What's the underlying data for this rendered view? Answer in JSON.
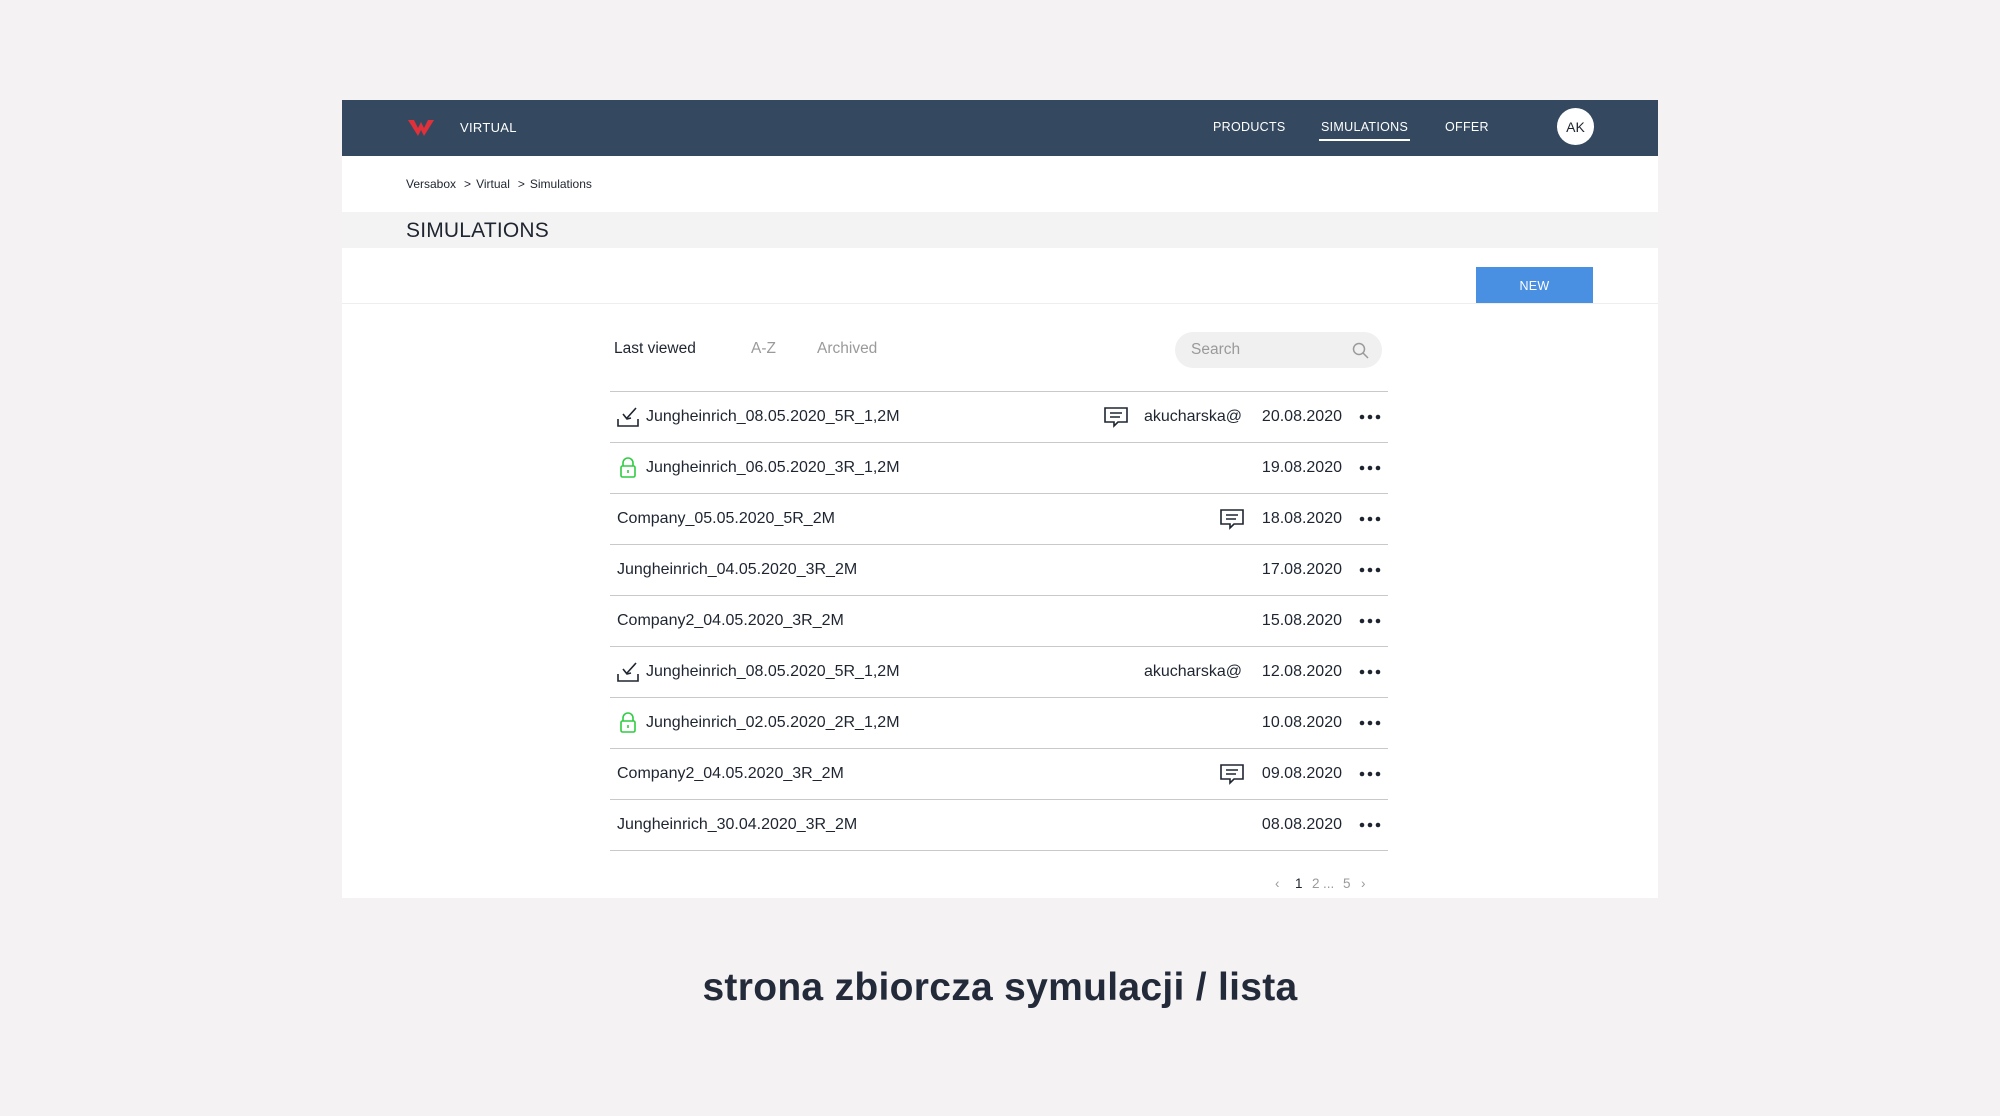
{
  "nav": {
    "brand": "VIRTUAL",
    "items": [
      {
        "label": "PRODUCTS"
      },
      {
        "label": "SIMULATIONS",
        "active": true
      },
      {
        "label": "OFFER"
      }
    ],
    "avatar_initials": "AK",
    "bar_color": "#34495f",
    "logo_color": "#e0303a"
  },
  "breadcrumb": [
    "Versabox",
    "Virtual",
    "Simulations"
  ],
  "page_title": "SIMULATIONS",
  "new_button_label": "NEW",
  "accent_color": "#4a90e2",
  "tabs": [
    {
      "label": "Last viewed",
      "active": true
    },
    {
      "label": "A-Z",
      "active": false
    },
    {
      "label": "Archived",
      "active": false
    }
  ],
  "search": {
    "placeholder": "Search"
  },
  "rows": [
    {
      "icon": "download-icon",
      "name": "Jungheinrich_08.05.2020_5R_1,2M",
      "comment": true,
      "user": "akucharska@",
      "date": "20.08.2020"
    },
    {
      "icon": "lock-icon",
      "name": "Jungheinrich_06.05.2020_3R_1,2M",
      "comment": false,
      "user": "",
      "date": "19.08.2020"
    },
    {
      "icon": "",
      "name": "Company_05.05.2020_5R_2M",
      "comment": true,
      "user": "",
      "date": "18.08.2020"
    },
    {
      "icon": "",
      "name": "Jungheinrich_04.05.2020_3R_2M",
      "comment": false,
      "user": "",
      "date": "17.08.2020"
    },
    {
      "icon": "",
      "name": "Company2_04.05.2020_3R_2M",
      "comment": false,
      "user": "",
      "date": "15.08.2020"
    },
    {
      "icon": "download-icon",
      "name": "Jungheinrich_08.05.2020_5R_1,2M",
      "comment": false,
      "user": "akucharska@",
      "date": "12.08.2020"
    },
    {
      "icon": "lock-icon",
      "name": "Jungheinrich_02.05.2020_2R_1,2M",
      "comment": false,
      "user": "",
      "date": "10.08.2020"
    },
    {
      "icon": "",
      "name": "Company2_04.05.2020_3R_2M",
      "comment": true,
      "user": "",
      "date": "09.08.2020"
    },
    {
      "icon": "",
      "name": "Jungheinrich_30.04.2020_3R_2M",
      "comment": false,
      "user": "",
      "date": "08.08.2020"
    }
  ],
  "pagination": {
    "prev": "‹",
    "pages": [
      "1",
      "2",
      "...",
      "5"
    ],
    "current": "1",
    "next": "›"
  },
  "lock_color": "#2ecc40",
  "caption": "strona zbiorcza symulacji / lista"
}
